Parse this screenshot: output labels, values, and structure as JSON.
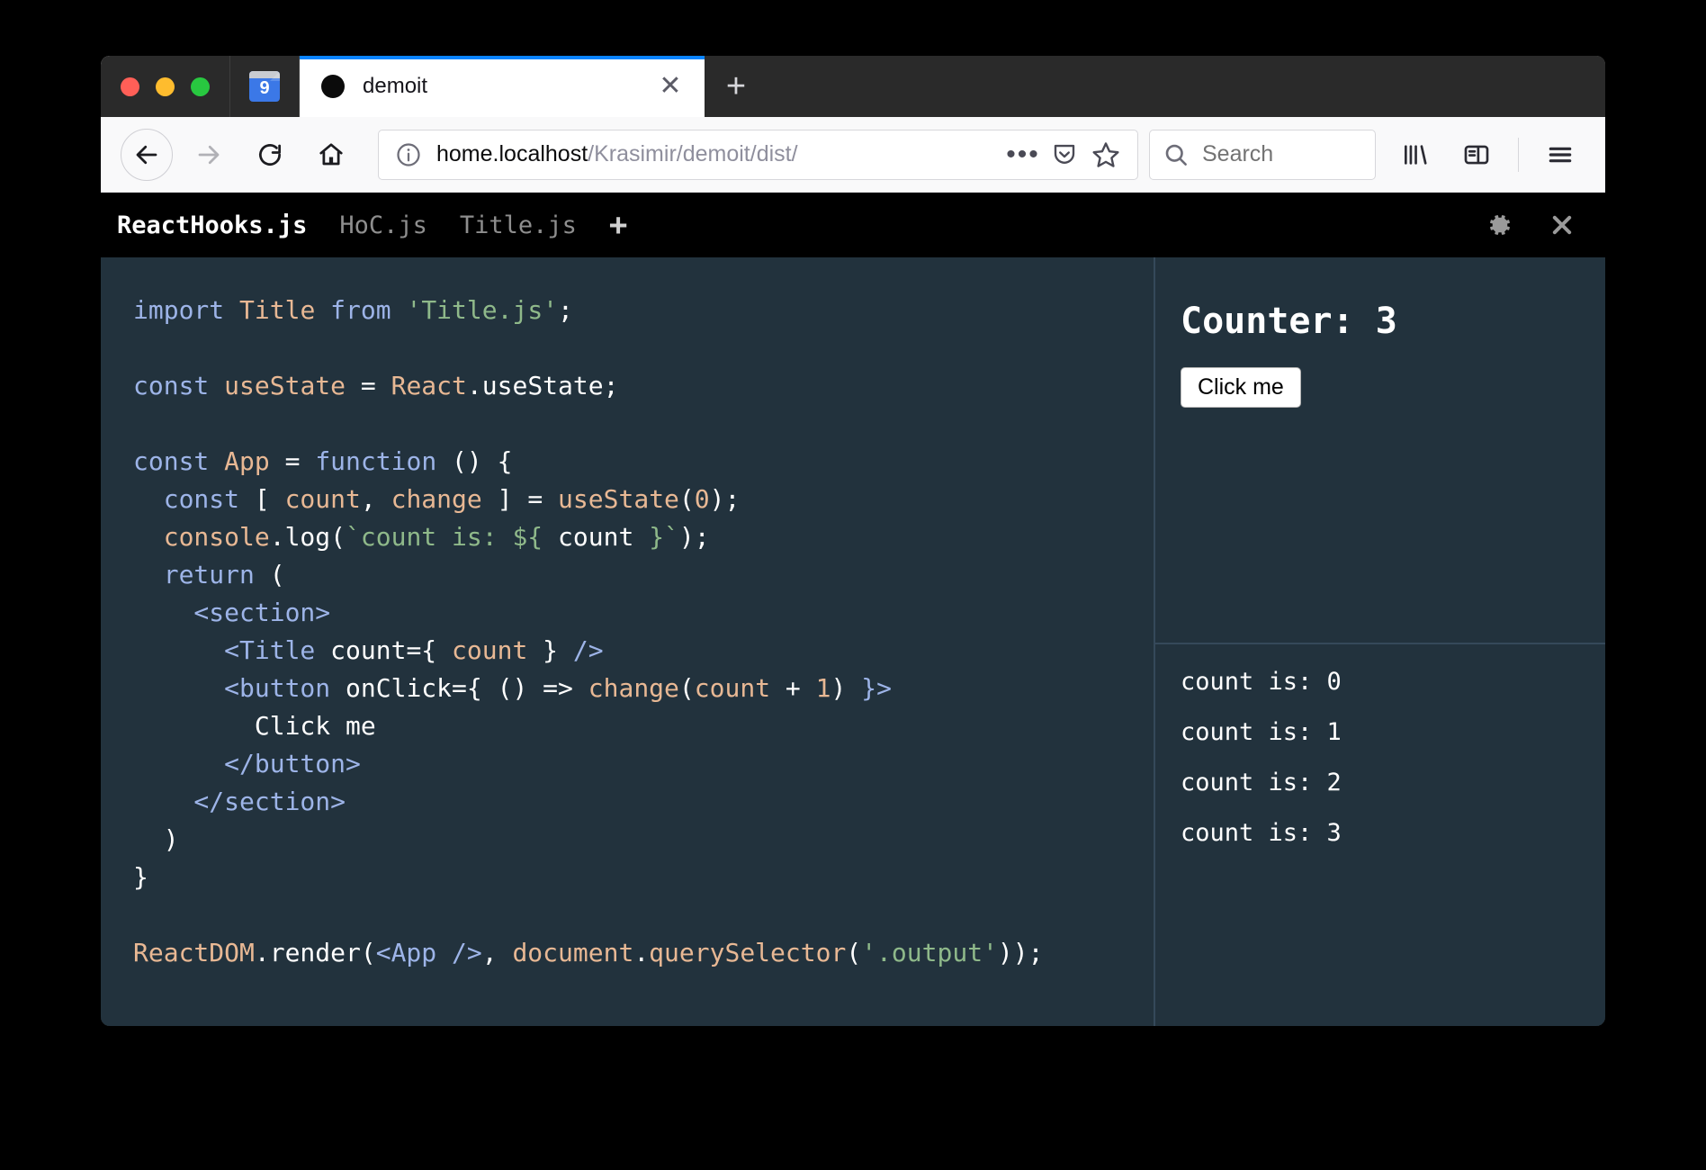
{
  "window": {
    "traffic_lights": [
      {
        "name": "close",
        "color": "#ff5f57"
      },
      {
        "name": "minimize",
        "color": "#febc2e"
      },
      {
        "name": "zoom",
        "color": "#28c840"
      }
    ]
  },
  "tabs": {
    "pinned": {
      "icon": "calendar-icon",
      "badge": "9"
    },
    "active": {
      "title": "demoit",
      "favicon": "circle-favicon",
      "close_label": "✕"
    },
    "new_tab_label": "+"
  },
  "navbar": {
    "back_label": "back-icon",
    "forward_label": "forward-icon",
    "reload_label": "reload-icon",
    "home_label": "home-icon",
    "url": {
      "host": "home.localhost",
      "path": "/Krasimir/demoit/dist/",
      "info_icon": "info-icon",
      "page_actions_label": "•••",
      "pocket_icon": "pocket-icon",
      "bookmark_icon": "star-icon"
    },
    "search": {
      "placeholder": "Search",
      "icon": "search-icon"
    },
    "library_icon": "library-icon",
    "sidebar_icon": "sidebar-icon",
    "menu_icon": "hamburger-menu-icon"
  },
  "demoit": {
    "files": [
      {
        "name": "ReactHooks.js",
        "active": true
      },
      {
        "name": "HoC.js",
        "active": false
      },
      {
        "name": "Title.js",
        "active": false
      }
    ],
    "add_file_label": "+",
    "settings_icon": "gear-icon",
    "close_icon": "close-icon",
    "code_lines": [
      [
        {
          "t": "import ",
          "c": "kw"
        },
        {
          "t": "Title ",
          "c": "id"
        },
        {
          "t": "from ",
          "c": "kw"
        },
        {
          "t": "'Title.js'",
          "c": "str"
        },
        {
          "t": ";",
          "c": "plain"
        }
      ],
      [],
      [
        {
          "t": "const ",
          "c": "kw"
        },
        {
          "t": "useState ",
          "c": "id"
        },
        {
          "t": "= ",
          "c": "plain"
        },
        {
          "t": "React",
          "c": "id"
        },
        {
          "t": ".",
          "c": "plain"
        },
        {
          "t": "useState",
          "c": "plain"
        },
        {
          "t": ";",
          "c": "plain"
        }
      ],
      [],
      [
        {
          "t": "const ",
          "c": "kw"
        },
        {
          "t": "App ",
          "c": "id"
        },
        {
          "t": "= ",
          "c": "plain"
        },
        {
          "t": "function ",
          "c": "kw"
        },
        {
          "t": "() {",
          "c": "plain"
        }
      ],
      [
        {
          "t": "  const ",
          "c": "kw"
        },
        {
          "t": "[ ",
          "c": "plain"
        },
        {
          "t": "count",
          "c": "id"
        },
        {
          "t": ", ",
          "c": "plain"
        },
        {
          "t": "change ",
          "c": "id"
        },
        {
          "t": "] = ",
          "c": "plain"
        },
        {
          "t": "useState",
          "c": "id"
        },
        {
          "t": "(",
          "c": "plain"
        },
        {
          "t": "0",
          "c": "id"
        },
        {
          "t": ");",
          "c": "plain"
        }
      ],
      [
        {
          "t": "  console",
          "c": "id"
        },
        {
          "t": ".log(",
          "c": "plain"
        },
        {
          "t": "`count is: ",
          "c": "str"
        },
        {
          "t": "${",
          "c": "str"
        },
        {
          "t": " count ",
          "c": "plain"
        },
        {
          "t": "}`",
          "c": "str"
        },
        {
          "t": ");",
          "c": "plain"
        }
      ],
      [
        {
          "t": "  return ",
          "c": "kw"
        },
        {
          "t": "(",
          "c": "plain"
        }
      ],
      [
        {
          "t": "    <section>",
          "c": "tag"
        }
      ],
      [
        {
          "t": "      <Title ",
          "c": "tag"
        },
        {
          "t": "count",
          "c": "plain"
        },
        {
          "t": "={ ",
          "c": "plain"
        },
        {
          "t": "count",
          "c": "id"
        },
        {
          "t": " } ",
          "c": "plain"
        },
        {
          "t": "/>",
          "c": "tag"
        }
      ],
      [
        {
          "t": "      <button ",
          "c": "tag"
        },
        {
          "t": "onClick",
          "c": "plain"
        },
        {
          "t": "={ () => ",
          "c": "plain"
        },
        {
          "t": "change",
          "c": "id"
        },
        {
          "t": "(",
          "c": "plain"
        },
        {
          "t": "count ",
          "c": "id"
        },
        {
          "t": "+ ",
          "c": "plain"
        },
        {
          "t": "1",
          "c": "id"
        },
        {
          "t": ") ",
          "c": "plain"
        },
        {
          "t": "}>",
          "c": "tag"
        }
      ],
      [
        {
          "t": "        Click me",
          "c": "plain"
        }
      ],
      [
        {
          "t": "      </button>",
          "c": "tag"
        }
      ],
      [
        {
          "t": "    </section>",
          "c": "tag"
        }
      ],
      [
        {
          "t": "  )",
          "c": "plain"
        }
      ],
      [
        {
          "t": "}",
          "c": "plain"
        }
      ],
      [],
      [
        {
          "t": "ReactDOM",
          "c": "id"
        },
        {
          "t": ".render(",
          "c": "plain"
        },
        {
          "t": "<App />",
          "c": "tag"
        },
        {
          "t": ", ",
          "c": "plain"
        },
        {
          "t": "document",
          "c": "id"
        },
        {
          "t": ".",
          "c": "plain"
        },
        {
          "t": "querySelector",
          "c": "id"
        },
        {
          "t": "(",
          "c": "plain"
        },
        {
          "t": "'.output'",
          "c": "str"
        },
        {
          "t": "));",
          "c": "plain"
        }
      ]
    ],
    "output": {
      "counter_title": "Counter: 3",
      "button_label": "Click me"
    },
    "console_lines": [
      "count is: 0",
      "count is: 1",
      "count is: 2",
      "count is: 3"
    ]
  },
  "colors": {
    "editor_bg": "#22323d",
    "chrome_bg": "#2a2a2a",
    "tab_accent": "#0a84ff",
    "keyword": "#9db4e8",
    "identifier": "#e8b894",
    "string": "#8fb98a"
  }
}
